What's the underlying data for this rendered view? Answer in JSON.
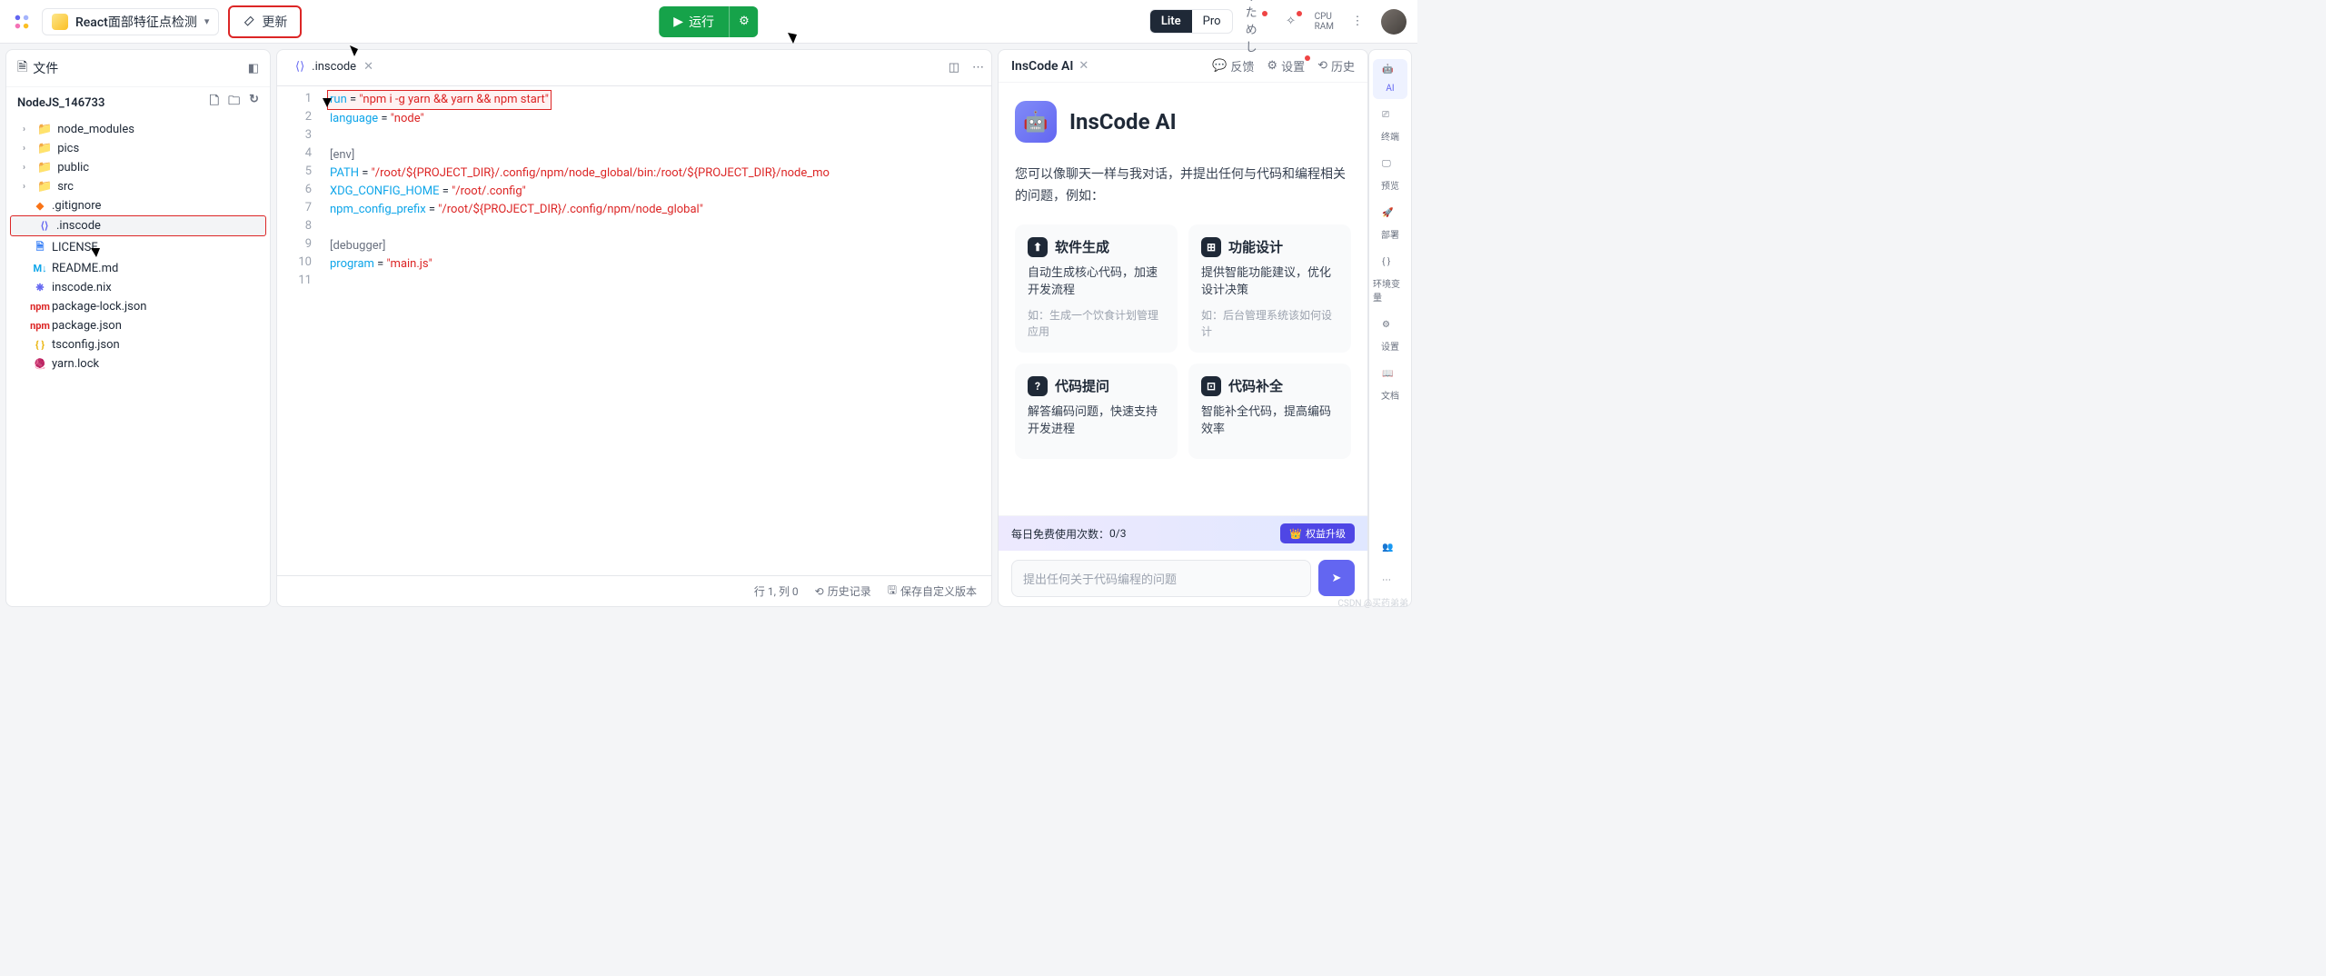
{
  "topbar": {
    "project_name": "React面部特征点检测",
    "update_label": "更新",
    "run_label": "运行",
    "plan_lite": "Lite",
    "plan_pro": "Pro",
    "cpu_label": "CPU",
    "ram_label": "RAM"
  },
  "files": {
    "panel_title": "文件",
    "project_root": "NodeJS_146733",
    "folders": [
      "node_modules",
      "pics",
      "public",
      "src"
    ],
    "items": [
      {
        "name": ".gitignore",
        "icon": "git",
        "color": "#f97316"
      },
      {
        "name": ".inscode",
        "icon": "inscode",
        "color": "#6366f1",
        "selected": true
      },
      {
        "name": "LICENSE",
        "icon": "doc",
        "color": "#3b82f6"
      },
      {
        "name": "README.md",
        "icon": "md",
        "color": "#0ea5e9"
      },
      {
        "name": "inscode.nix",
        "icon": "nix",
        "color": "#6366f1"
      },
      {
        "name": "package-lock.json",
        "icon": "npm",
        "color": "#dc2626"
      },
      {
        "name": "package.json",
        "icon": "npm",
        "color": "#dc2626"
      },
      {
        "name": "tsconfig.json",
        "icon": "ts",
        "color": "#eab308"
      },
      {
        "name": "yarn.lock",
        "icon": "yarn",
        "color": "#3b82f6"
      }
    ]
  },
  "editor": {
    "tab_name": ".inscode",
    "lines": [
      {
        "n": 1,
        "html": "<span class='hl-line'><span class='s1'>run</span> = <span class='s2'>\"npm i -g yarn && yarn && npm start\"</span></span>"
      },
      {
        "n": 2,
        "html": "<span class='s1'>language</span> = <span class='s2'>\"node\"</span>"
      },
      {
        "n": 3,
        "html": ""
      },
      {
        "n": 4,
        "html": "<span class='s3'>[env]</span>"
      },
      {
        "n": 5,
        "html": "<span class='s1'>PATH</span> = <span class='s2'>\"/root/${PROJECT_DIR}/.config/npm/node_global/bin:/root/${PROJECT_DIR}/node_mo</span>"
      },
      {
        "n": 6,
        "html": "<span class='s1'>XDG_CONFIG_HOME</span> = <span class='s2'>\"/root/.config\"</span>"
      },
      {
        "n": 7,
        "html": "<span class='s1'>npm_config_prefix</span> = <span class='s2'>\"/root/${PROJECT_DIR}/.config/npm/node_global\"</span>"
      },
      {
        "n": 8,
        "html": ""
      },
      {
        "n": 9,
        "html": "<span class='s3'>[debugger]</span>"
      },
      {
        "n": 10,
        "html": "<span class='s1'>program</span> = <span class='s2'>\"main.js\"</span>"
      },
      {
        "n": 11,
        "html": ""
      }
    ],
    "status_pos": "行 1, 列 0",
    "status_history": "历史记录",
    "status_save": "保存自定义版本"
  },
  "ai": {
    "panel_title": "InsCode AI",
    "feedback": "反馈",
    "settings": "设置",
    "history": "历史",
    "brand_title": "InsCode AI",
    "intro": "您可以像聊天一样与我对话，并提出任何与代码和编程相关的问题，例如：",
    "cards": [
      {
        "title": "软件生成",
        "desc": "自动生成核心代码，加速开发流程",
        "hint": "如：生成一个饮食计划管理应用"
      },
      {
        "title": "功能设计",
        "desc": "提供智能功能建议，优化设计决策",
        "hint": "如：后台管理系统该如何设计"
      },
      {
        "title": "代码提问",
        "desc": "解答编码问题，快速支持开发进程",
        "hint": ""
      },
      {
        "title": "代码补全",
        "desc": "智能补全代码，提高编码效率",
        "hint": ""
      }
    ],
    "quota_label": "每日免费使用次数：",
    "quota_value": "0/3",
    "upgrade": "权益升级",
    "input_placeholder": "提出任何关于代码编程的问题"
  },
  "rail": [
    {
      "label": "AI",
      "active": true
    },
    {
      "label": "终端"
    },
    {
      "label": "预览"
    },
    {
      "label": "部署"
    },
    {
      "label": "环境变量"
    },
    {
      "label": "设置"
    },
    {
      "label": "文档"
    }
  ],
  "watermark": "CSDN @买药弟弟"
}
